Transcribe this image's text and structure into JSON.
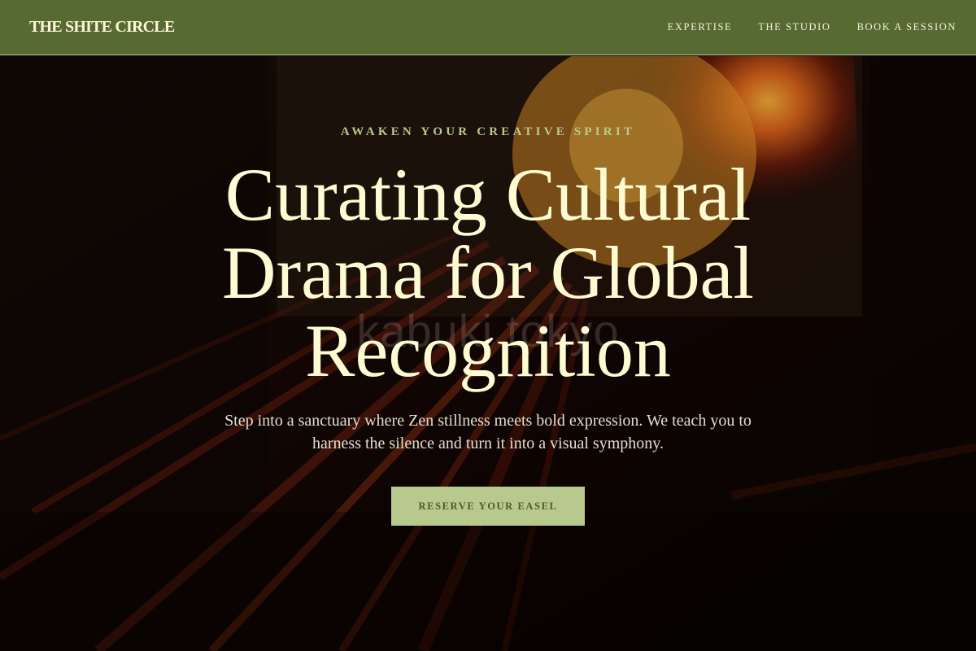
{
  "nav": {
    "brand": "THE SHITE CIRCLE",
    "links": [
      {
        "label": "EXPERTISE"
      },
      {
        "label": "THE STUDIO"
      },
      {
        "label": "BOOK A SESSION"
      }
    ]
  },
  "hero": {
    "eyebrow": "AWAKEN YOUR CREATIVE SPIRIT",
    "headline": "Curating Cultural Drama for Global Recognition",
    "subtext": "Step into a sanctuary where Zen stillness meets bold expression. We teach you to harness the silence and turn it into a visual symphony.",
    "cta_label": "RESERVE YOUR EASEL",
    "background_watermark": "kabuki tokyo"
  },
  "colors": {
    "nav_bg": "#566a32",
    "accent": "#b8c98e",
    "headline": "#fefbd2",
    "cta_text": "#4c5a2c"
  }
}
